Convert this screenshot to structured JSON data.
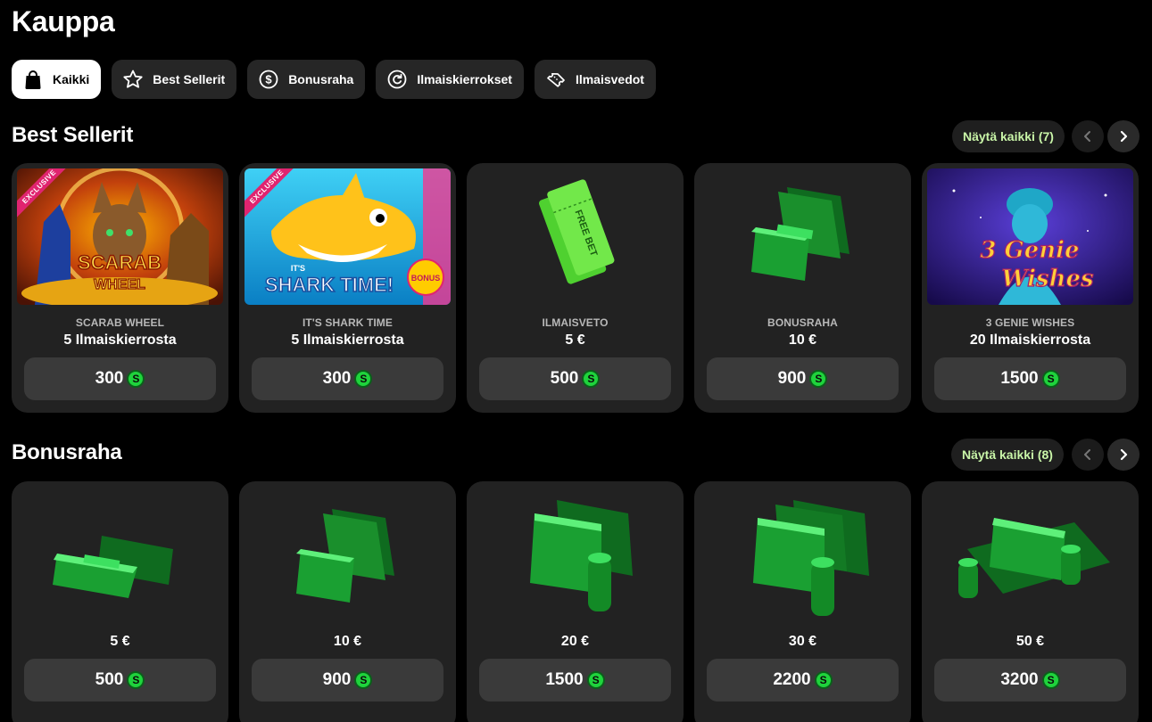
{
  "page": {
    "title": "Kauppa"
  },
  "filters": [
    {
      "label": "Kaikki",
      "icon": "shopping-bag-icon",
      "active": true
    },
    {
      "label": "Best Sellerit",
      "icon": "star-icon",
      "active": false
    },
    {
      "label": "Bonusraha",
      "icon": "dollar-coin-icon",
      "active": false
    },
    {
      "label": "Ilmaiskierrokset",
      "icon": "spin-icon",
      "active": false
    },
    {
      "label": "Ilmaisvedot",
      "icon": "ticket-icon",
      "active": false
    }
  ],
  "best_sellers": {
    "title": "Best Sellerit",
    "see_all": "Näytä kaikki (7)",
    "items": [
      {
        "sub": "SCARAB WHEEL",
        "title": "5 Ilmaiskierrosta",
        "price": "300",
        "badge": "EXCLUSIVE",
        "art_text": "SCARAB WHEEL"
      },
      {
        "sub": "IT'S SHARK TIME",
        "title": "5 Ilmaiskierrosta",
        "price": "300",
        "badge": "EXCLUSIVE",
        "art_text": "IT'S SHARK TIME!"
      },
      {
        "sub": "ILMAISVETO",
        "title": "5 €",
        "price": "500",
        "art_text": "FREE BET"
      },
      {
        "sub": "BONUSRAHA",
        "title": "10 €",
        "price": "900"
      },
      {
        "sub": "3 GENIE WISHES",
        "title": "20 Ilmaiskierrosta",
        "price": "1500",
        "art_text": "3 Genie Wishes"
      }
    ]
  },
  "bonusraha": {
    "title": "Bonusraha",
    "see_all": "Näytä kaikki (8)",
    "items": [
      {
        "title": "5 €",
        "price": "500"
      },
      {
        "title": "10 €",
        "price": "900"
      },
      {
        "title": "20 €",
        "price": "1500"
      },
      {
        "title": "30 €",
        "price": "2200"
      },
      {
        "title": "50 €",
        "price": "3200"
      }
    ]
  },
  "currency": {
    "symbol": "S",
    "color": "#1fd33c"
  },
  "colors": {
    "see_all_text": "#c9f5a8",
    "card_bg": "#222222",
    "price_bg": "#3a3a3a"
  }
}
